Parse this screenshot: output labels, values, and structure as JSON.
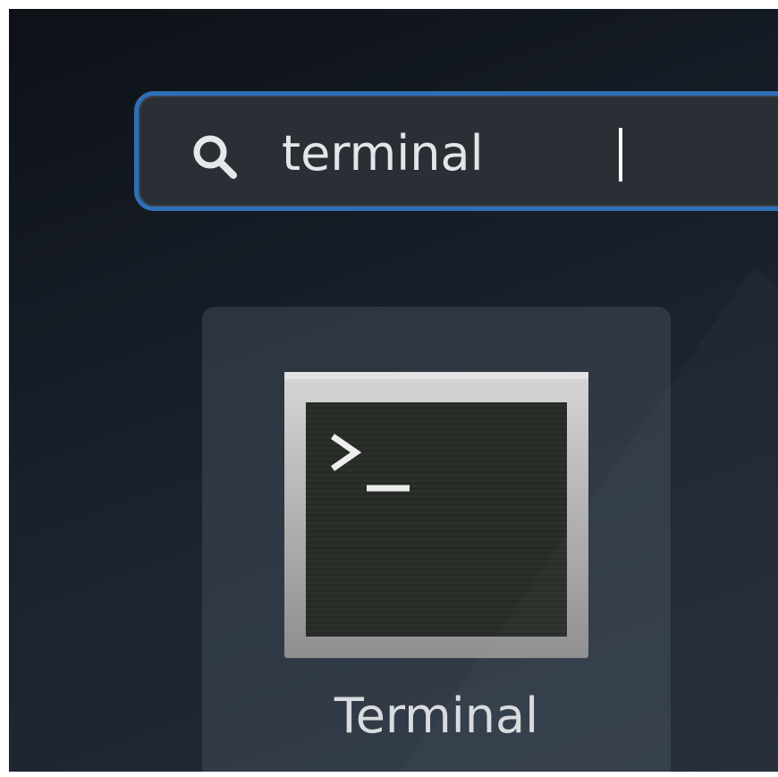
{
  "search": {
    "query": "terminal",
    "icon": "search-icon"
  },
  "results": [
    {
      "label": "Terminal",
      "icon": "terminal-icon"
    }
  ],
  "colors": {
    "accent": "#2f6fb8",
    "search_bg": "#2a2f36",
    "text": "#e3e5e8"
  }
}
